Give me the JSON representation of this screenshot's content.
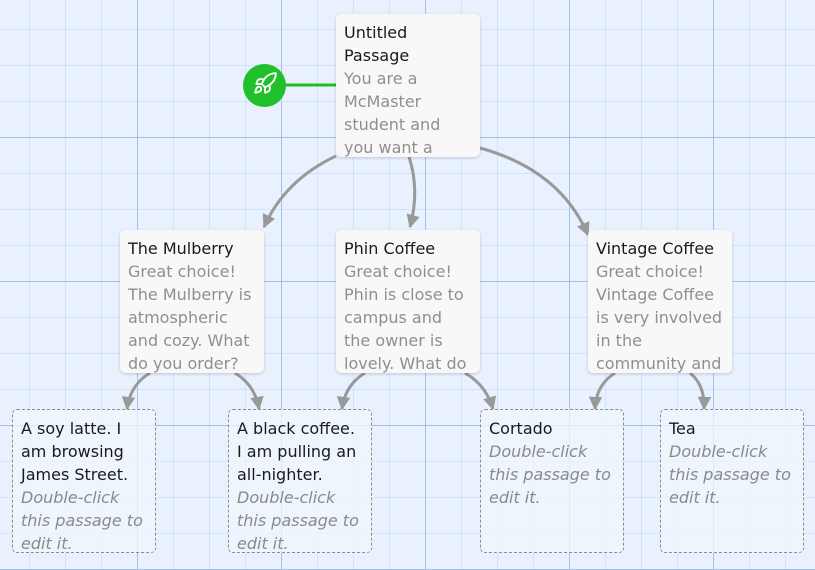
{
  "start_marker": {
    "icon": "rocket-icon",
    "color": "#20c02a"
  },
  "colors": {
    "link": "#999999",
    "start_link": "#22bb22",
    "grid": "#8ab8ea",
    "background": "#e8f1fd"
  },
  "passages": [
    {
      "id": "untitled",
      "title": "Untitled Passage",
      "excerpt": "You are a McMaster student and you want a coffee. Where do you"
    },
    {
      "id": "mulberry",
      "title": "The Mulberry",
      "excerpt": "Great choice! The Mulberry is atmospheric and cozy. What do you order? [["
    },
    {
      "id": "phin",
      "title": "Phin Coffee",
      "excerpt": "Great choice! Phin is close to campus and the owner is lovely. What do you"
    },
    {
      "id": "vintage",
      "title": "Vintage Coffee",
      "excerpt": "Great choice! Vintage Coffee is very involved in the community and"
    },
    {
      "id": "soy-latte",
      "title": "A soy latte. I am browsing James Street.",
      "excerpt": "Double-click this passage to edit it."
    },
    {
      "id": "black-coffee",
      "title": "A black coffee. I am pulling an all-nighter.",
      "excerpt": "Double-click this passage to edit it."
    },
    {
      "id": "cortado",
      "title": "Cortado",
      "excerpt": "Double-click this passage to edit it."
    },
    {
      "id": "tea",
      "title": "Tea",
      "excerpt": "Double-click this passage to edit it."
    }
  ]
}
